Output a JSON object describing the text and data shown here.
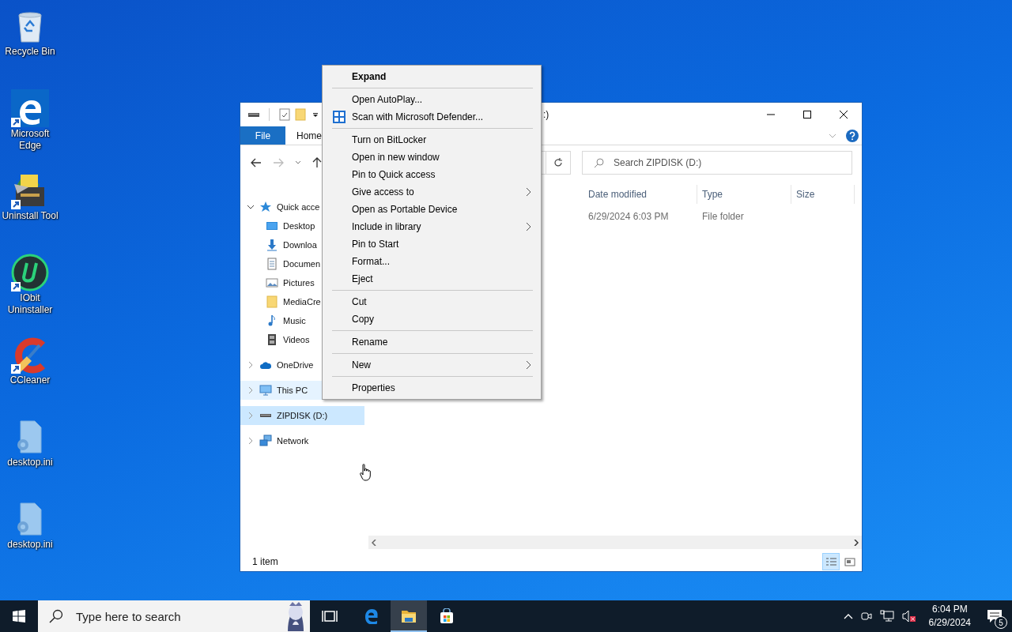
{
  "desktop_icons": [
    {
      "label": "Recycle Bin",
      "kind": "recycle",
      "shortcut": false
    },
    {
      "label": "Microsoft Edge",
      "kind": "edge",
      "shortcut": true
    },
    {
      "label": "Uninstall Tool",
      "kind": "cabinet",
      "shortcut": true
    },
    {
      "label": "IObit Uninstaller",
      "kind": "iobit",
      "shortcut": true
    },
    {
      "label": "CCleaner",
      "kind": "ccleaner",
      "shortcut": true
    },
    {
      "label": "desktop.ini",
      "kind": "ini",
      "shortcut": false
    },
    {
      "label": "desktop.ini",
      "kind": "ini",
      "shortcut": false
    }
  ],
  "explorer": {
    "title": ":)",
    "ribbon_tabs": [
      {
        "label": "File",
        "kind": "file_menu",
        "selected": false
      },
      {
        "label": "Home",
        "kind": "tab",
        "selected": false
      }
    ],
    "search": {
      "placeholder": "Search ZIPDISK (D:)"
    },
    "navigation": [
      {
        "label": "Quick acce",
        "kind": "star",
        "expanded": true,
        "selected": false,
        "highlighted": false,
        "children": [
          {
            "label": "Desktop",
            "kind": "desktop",
            "selected": false,
            "highlighted": false
          },
          {
            "label": "Downloa",
            "kind": "download",
            "selected": false,
            "highlighted": false
          },
          {
            "label": "Documen",
            "kind": "document",
            "selected": false,
            "highlighted": false
          },
          {
            "label": "Pictures",
            "kind": "pictures",
            "selected": false,
            "highlighted": false
          },
          {
            "label": "MediaCre",
            "kind": "folder",
            "selected": false,
            "highlighted": false
          },
          {
            "label": "Music",
            "kind": "music",
            "selected": false,
            "highlighted": false
          },
          {
            "label": "Videos",
            "kind": "videos",
            "selected": false,
            "highlighted": false
          }
        ]
      },
      {
        "label": "OneDrive",
        "kind": "cloud",
        "expanded": false,
        "selected": false,
        "highlighted": false
      },
      {
        "label": "This PC",
        "kind": "pc",
        "expanded": false,
        "selected": false,
        "highlighted": true
      },
      {
        "label": "ZIPDISK (D:)",
        "kind": "drive",
        "expanded": false,
        "selected": true,
        "highlighted": false
      },
      {
        "label": "Network",
        "kind": "network",
        "expanded": false,
        "selected": false,
        "highlighted": false
      }
    ],
    "columns": [
      "Date modified",
      "Type",
      "Size"
    ],
    "rows": [
      {
        "cells": [
          "6/29/2024 6:03 PM",
          "File folder",
          ""
        ]
      }
    ],
    "status_bar": "1 item",
    "views": [
      {
        "kind": "details",
        "selected": true
      },
      {
        "kind": "large_icons",
        "selected": false
      }
    ]
  },
  "context_menu": [
    {
      "kind": "item",
      "label": "Expand",
      "default": true
    },
    {
      "kind": "separator"
    },
    {
      "kind": "item",
      "label": "Open AutoPlay...",
      "default": false
    },
    {
      "kind": "icon_item",
      "label": "Scan with Microsoft Defender...",
      "default": false
    },
    {
      "kind": "separator"
    },
    {
      "kind": "item",
      "label": "Turn on BitLocker",
      "default": false
    },
    {
      "kind": "item",
      "label": "Open in new window",
      "default": false
    },
    {
      "kind": "item",
      "label": "Pin to Quick access",
      "default": false
    },
    {
      "kind": "item",
      "label": "Give access to",
      "default": false,
      "submenu": true
    },
    {
      "kind": "item",
      "label": "Open as Portable Device",
      "default": false
    },
    {
      "kind": "item",
      "label": "Include in library",
      "default": false,
      "submenu": true
    },
    {
      "kind": "item",
      "label": "Pin to Start",
      "default": false
    },
    {
      "kind": "item",
      "label": "Format...",
      "default": false
    },
    {
      "kind": "item",
      "label": "Eject",
      "default": false
    },
    {
      "kind": "separator"
    },
    {
      "kind": "item",
      "label": "Cut",
      "default": false
    },
    {
      "kind": "item",
      "label": "Copy",
      "default": false
    },
    {
      "kind": "separator"
    },
    {
      "kind": "item",
      "label": "Rename",
      "default": false
    },
    {
      "kind": "separator"
    },
    {
      "kind": "item",
      "label": "New",
      "default": false,
      "submenu": true
    },
    {
      "kind": "separator"
    },
    {
      "kind": "item",
      "label": "Properties",
      "default": false
    }
  ],
  "taskbar": {
    "search": {
      "placeholder": "Type here to search"
    },
    "apps": [
      {
        "kind": "task_view",
        "active": false
      },
      {
        "kind": "edge",
        "active": false
      },
      {
        "kind": "explorer",
        "active": true
      },
      {
        "kind": "store",
        "active": false
      }
    ],
    "time": "6:04 PM",
    "date": "6/29/2024",
    "notification_count": "5"
  }
}
